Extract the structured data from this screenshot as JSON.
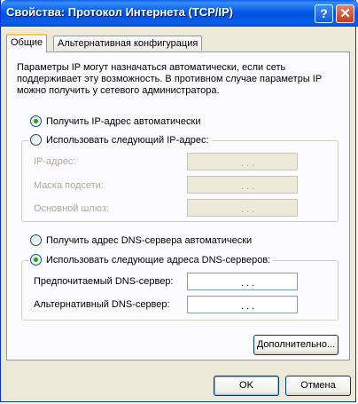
{
  "window": {
    "title": "Свойства: Протокол Интернета (TCP/IP)",
    "help_label": "?",
    "close_label": "✕"
  },
  "tabs": [
    {
      "label": "Общие",
      "active": true
    },
    {
      "label": "Альтернативная конфигурация",
      "active": false
    }
  ],
  "description": "Параметры IP могут назначаться автоматически, если сеть поддерживает эту возможность. В противном случае параметры IP можно получить у сетевого администратора.",
  "ip": {
    "auto_label": "Получить IP-адрес автоматически",
    "auto_checked": true,
    "manual_label": "Использовать следующий IP-адрес:",
    "manual_checked": false,
    "address_label": "IP-адрес:",
    "mask_label": "Маска подсети:",
    "gateway_label": "Основной шлюз:",
    "address_value": ". . .",
    "mask_value": ". . .",
    "gateway_value": ". . ."
  },
  "dns": {
    "auto_label": "Получить адрес DNS-сервера автоматически",
    "auto_checked": false,
    "manual_label": "Использовать следующие адреса DNS-серверов:",
    "manual_checked": true,
    "preferred_label": "Предпочитаемый DNS-сервер:",
    "alternate_label": "Альтернативный DNS-сервер:",
    "preferred_value": ". . .",
    "alternate_value": ". . ."
  },
  "buttons": {
    "advanced": "Дополнительно...",
    "ok": "OK",
    "cancel": "Отмена"
  },
  "colors": {
    "titlebar": "#0058e6",
    "dialog_bg": "#ece9d8",
    "radio_dot": "#21a121"
  }
}
